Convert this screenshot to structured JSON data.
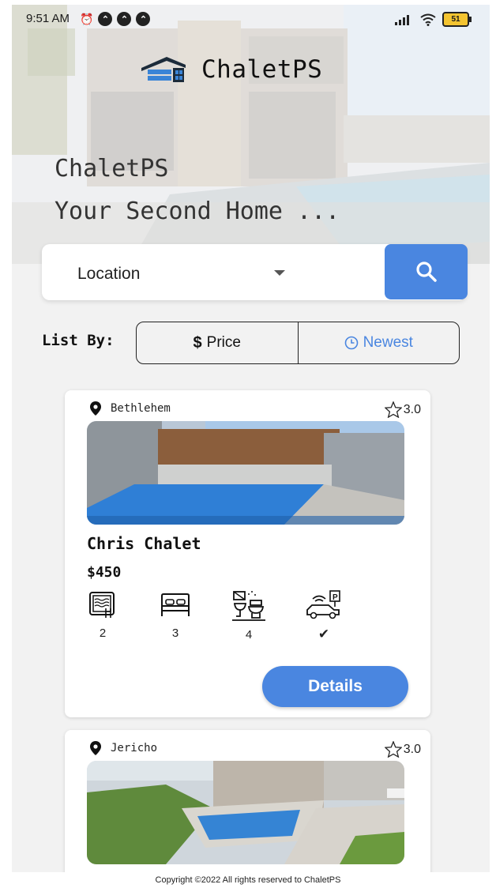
{
  "status_bar": {
    "time": "9:51 AM",
    "battery": "51"
  },
  "brand": {
    "name": "ChaletPS"
  },
  "hero": {
    "title": "ChaletPS",
    "subtitle": "Your Second Home ..."
  },
  "search": {
    "location_label": "Location"
  },
  "list_by": {
    "label": "List By:",
    "options": [
      {
        "label": "Price",
        "icon": "dollar-icon"
      },
      {
        "label": "Newest",
        "icon": "clock-icon",
        "color": "#4a86e0"
      }
    ]
  },
  "listings": [
    {
      "location": "Bethlehem",
      "rating": "3.0",
      "title": "Chris Chalet",
      "price": "$450",
      "amenities": [
        {
          "icon": "pool-icon",
          "value": "2"
        },
        {
          "icon": "bed-icon",
          "value": "3"
        },
        {
          "icon": "bathroom-icon",
          "value": "4"
        },
        {
          "icon": "parking-icon",
          "value": "✔"
        }
      ],
      "details_label": "Details"
    },
    {
      "location": "Jericho",
      "rating": "3.0"
    }
  ],
  "footer": "Copyright ©2022 All rights reserved to ChaletPS",
  "colors": {
    "accent": "#4a86e0"
  }
}
